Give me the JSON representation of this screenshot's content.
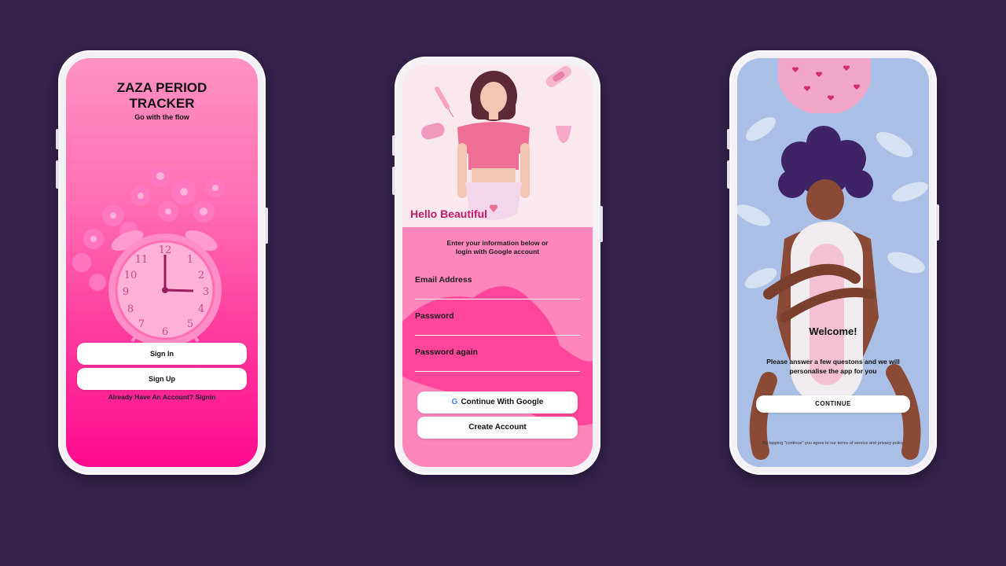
{
  "colors": {
    "background": "#35224d",
    "brand_pink": "#ff0a8d",
    "accent_magenta": "#c21a69",
    "form_pink": "#ff86bb",
    "button_bg": "#ffffff"
  },
  "screen1": {
    "title": "ZAZA PERIOD\nTRACKER",
    "subtitle": "Go with the flow",
    "illustration": "alarm-clock-with-flowers",
    "sign_in_label": "Sign In",
    "sign_up_label": "Sign Up",
    "already_account_text": "Already Have An Account? Signin"
  },
  "screen2": {
    "greeting": "Hello Beautiful",
    "illustration": "woman-with-period-products",
    "intro_text": "Enter your information below or\nlogin with Google account",
    "fields": [
      {
        "label": "Email Address"
      },
      {
        "label": "Password"
      },
      {
        "label": "Password again"
      }
    ],
    "google_button_label": "Continue With Google",
    "google_icon": "google-icon",
    "create_account_label": "Create Account"
  },
  "screen3": {
    "illustration": "woman-hugging-pad",
    "welcome_title": "Welcome!",
    "welcome_text": "Please answer a few questons and we will\npersonalise the app for you",
    "continue_label": "CONTINUE",
    "terms_text": "By tapping \"continue\" you agree to our terms of service and privacy policy"
  }
}
